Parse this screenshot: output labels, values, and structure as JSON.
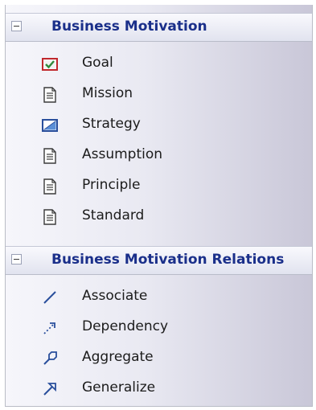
{
  "sections": [
    {
      "title": "Business Motivation",
      "items": [
        {
          "label": "Goal",
          "icon": "goal-icon"
        },
        {
          "label": "Mission",
          "icon": "document-icon"
        },
        {
          "label": "Strategy",
          "icon": "strategy-icon"
        },
        {
          "label": "Assumption",
          "icon": "document-icon"
        },
        {
          "label": "Principle",
          "icon": "document-icon"
        },
        {
          "label": "Standard",
          "icon": "document-icon"
        }
      ]
    },
    {
      "title": "Business Motivation Relations",
      "items": [
        {
          "label": "Associate",
          "icon": "associate-icon"
        },
        {
          "label": "Dependency",
          "icon": "dependency-icon"
        },
        {
          "label": "Aggregate",
          "icon": "aggregate-icon"
        },
        {
          "label": "Generalize",
          "icon": "generalize-icon"
        }
      ]
    }
  ],
  "colors": {
    "section_title": "#1a2f8a",
    "icon_blue": "#2a4f9c",
    "goal_red": "#c0282d"
  }
}
